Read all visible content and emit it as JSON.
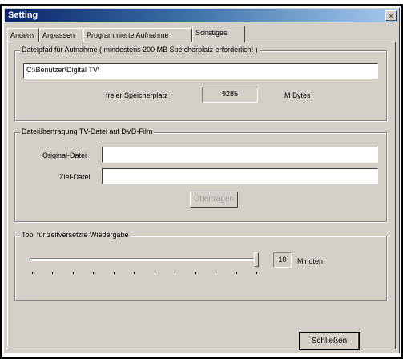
{
  "window": {
    "title": "Setting",
    "close_glyph": "×"
  },
  "tabs": [
    {
      "label": "Andern",
      "active": false
    },
    {
      "label": "Anpassen",
      "active": false
    },
    {
      "label": "Programmierte Aufnahme",
      "active": false
    },
    {
      "label": "Sonstiges",
      "active": true
    }
  ],
  "recording_path": {
    "group_label": "Dateipfad für Aufnahme ( mindestens 200 MB Speicherplatz erforderlich! )",
    "path_value": "C:\\Benutzer\\Digital TV\\",
    "free_space_label": "freier Speicherplatz",
    "free_space_value": "9285",
    "free_space_unit": "M Bytes"
  },
  "dvd_transfer": {
    "group_label": "Dateiübertragung TV-Datei auf DVD-Film",
    "original_label": "Original-Datei",
    "original_value": "",
    "target_label": "Ziel-Datei",
    "target_value": "",
    "transfer_button": "Übertragen"
  },
  "timeshift": {
    "group_label": "Tool für zeitversetzte Wiedergabe",
    "slider_level": 1.0,
    "minutes_value": "10",
    "minutes_unit": "Minuten"
  },
  "footer": {
    "close_button": "Schließen"
  }
}
